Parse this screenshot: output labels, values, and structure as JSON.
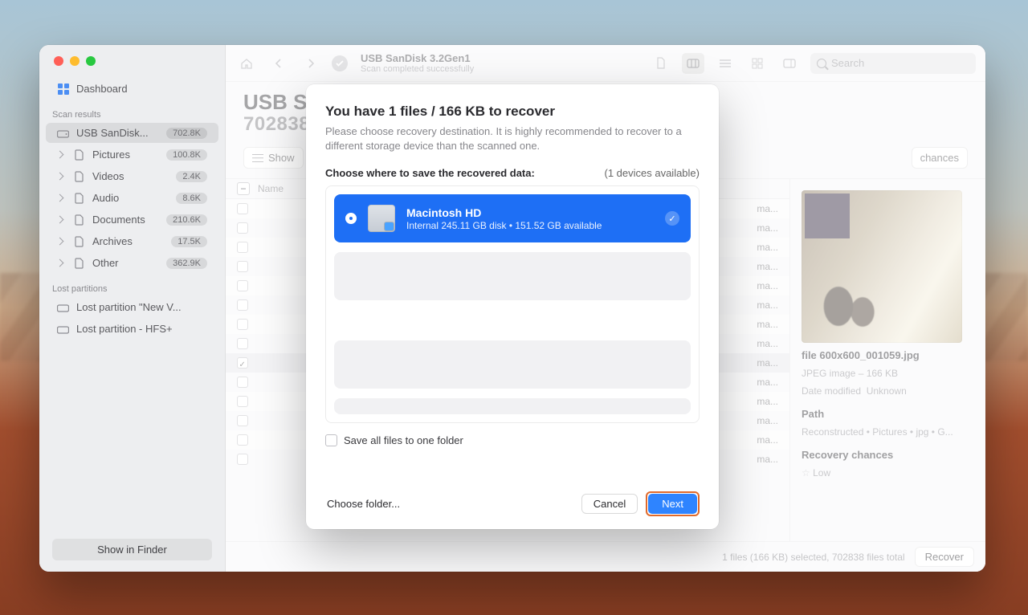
{
  "sidebar": {
    "dashboard": "Dashboard",
    "scan_results_head": "Scan results",
    "items": [
      {
        "label": "USB  SanDisk...",
        "badge": "702.8K",
        "icon": "drive-icon"
      },
      {
        "label": "Pictures",
        "badge": "100.8K",
        "icon": "file-icon"
      },
      {
        "label": "Videos",
        "badge": "2.4K",
        "icon": "file-icon"
      },
      {
        "label": "Audio",
        "badge": "8.6K",
        "icon": "file-icon"
      },
      {
        "label": "Documents",
        "badge": "210.6K",
        "icon": "file-icon"
      },
      {
        "label": "Archives",
        "badge": "17.5K",
        "icon": "file-icon"
      },
      {
        "label": "Other",
        "badge": "362.9K",
        "icon": "file-icon"
      }
    ],
    "lost_head": "Lost partitions",
    "lost": [
      {
        "label": "Lost partition \"New V..."
      },
      {
        "label": "Lost partition - HFS+"
      }
    ],
    "show_in_finder": "Show in Finder"
  },
  "toolbar": {
    "device_title": "USB  SanDisk 3.2Gen1",
    "device_sub": "Scan completed successfully",
    "search_placeholder": "Search"
  },
  "page_head": {
    "title": "USB  S",
    "subtitle": "702838"
  },
  "filters": {
    "show": "Show",
    "chances": "chances"
  },
  "table": {
    "name_col": "Name",
    "rows": [
      {
        "checked": false,
        "tail": "ma..."
      },
      {
        "checked": false,
        "tail": "ma..."
      },
      {
        "checked": false,
        "tail": "ma..."
      },
      {
        "checked": false,
        "tail": "ma..."
      },
      {
        "checked": false,
        "tail": "ma..."
      },
      {
        "checked": false,
        "tail": "ma..."
      },
      {
        "checked": false,
        "tail": "ma..."
      },
      {
        "checked": false,
        "tail": "ma..."
      },
      {
        "checked": true,
        "tail": "ma...",
        "selected": true
      },
      {
        "checked": false,
        "tail": "ma..."
      },
      {
        "checked": false,
        "tail": "ma..."
      },
      {
        "checked": false,
        "tail": "ma..."
      },
      {
        "checked": false,
        "tail": "ma..."
      },
      {
        "checked": false,
        "tail": "ma..."
      }
    ]
  },
  "detail": {
    "file_name": "file 600x600_001059.jpg",
    "file_type": "JPEG image – 166 KB",
    "date_label": "Date modified",
    "date_value": "Unknown",
    "path_label": "Path",
    "path_value": "Reconstructed • Pictures • jpg • G...",
    "chances_label": "Recovery chances",
    "chances_value": "Low"
  },
  "status": {
    "summary": "1 files (166 KB) selected, 702838 files total",
    "recover": "Recover"
  },
  "modal": {
    "title": "You have 1 files / 166 KB to recover",
    "subtitle": "Please choose recovery destination. It is highly recommended to recover to a different storage device than the scanned one.",
    "where_label": "Choose where to save the recovered data:",
    "devices_available": "(1 devices available)",
    "device": {
      "name": "Macintosh HD",
      "sub": "Internal 245.11 GB disk • 151.52 GB available"
    },
    "save_all": "Save all files to one folder",
    "choose_folder": "Choose folder...",
    "cancel": "Cancel",
    "next": "Next"
  }
}
